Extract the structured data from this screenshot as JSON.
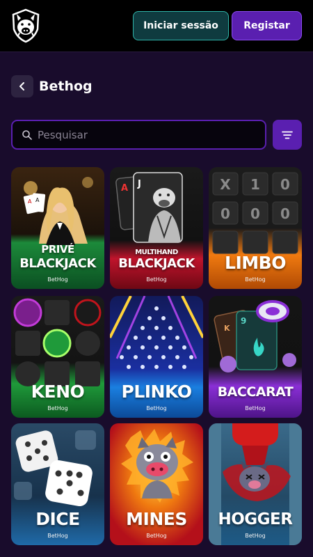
{
  "header": {
    "login_label": "Iniciar sessão",
    "register_label": "Registar"
  },
  "page": {
    "title": "Bethog"
  },
  "search": {
    "placeholder": "Pesquisar"
  },
  "games": [
    {
      "title_line1": "PRIVÉ",
      "title_line2": "BLACKJACK",
      "provider": "BetHog",
      "color": "#1c8a3a"
    },
    {
      "title_line1": "MULTIHAND",
      "title_line2": "BLACKJACK",
      "provider": "BetHog",
      "color": "#c0142c"
    },
    {
      "title_line1": "",
      "title_line2": "LIMBO",
      "provider": "BetHog",
      "color": "#f07a10"
    },
    {
      "title_line1": "",
      "title_line2": "KENO",
      "provider": "BetHog",
      "color": "#1f9a3a"
    },
    {
      "title_line1": "",
      "title_line2": "PLINKO",
      "provider": "BetHog",
      "color": "#1a7fe0"
    },
    {
      "title_line1": "",
      "title_line2": "BACCARAT",
      "provider": "BetHog",
      "color": "#8a2fd6"
    },
    {
      "title_line1": "",
      "title_line2": "DICE",
      "provider": "BetHog",
      "color": "#1f6aa8"
    },
    {
      "title_line1": "",
      "title_line2": "MINES",
      "provider": "BetHog",
      "color": "#d4141c"
    },
    {
      "title_line1": "",
      "title_line2": "HOGGER",
      "provider": "BetHog",
      "color": "#1d5a86"
    }
  ],
  "icons": {
    "logo": "hog-shield-logo",
    "back": "chevron-left-icon",
    "search": "search-icon",
    "filter": "filter-icon"
  }
}
